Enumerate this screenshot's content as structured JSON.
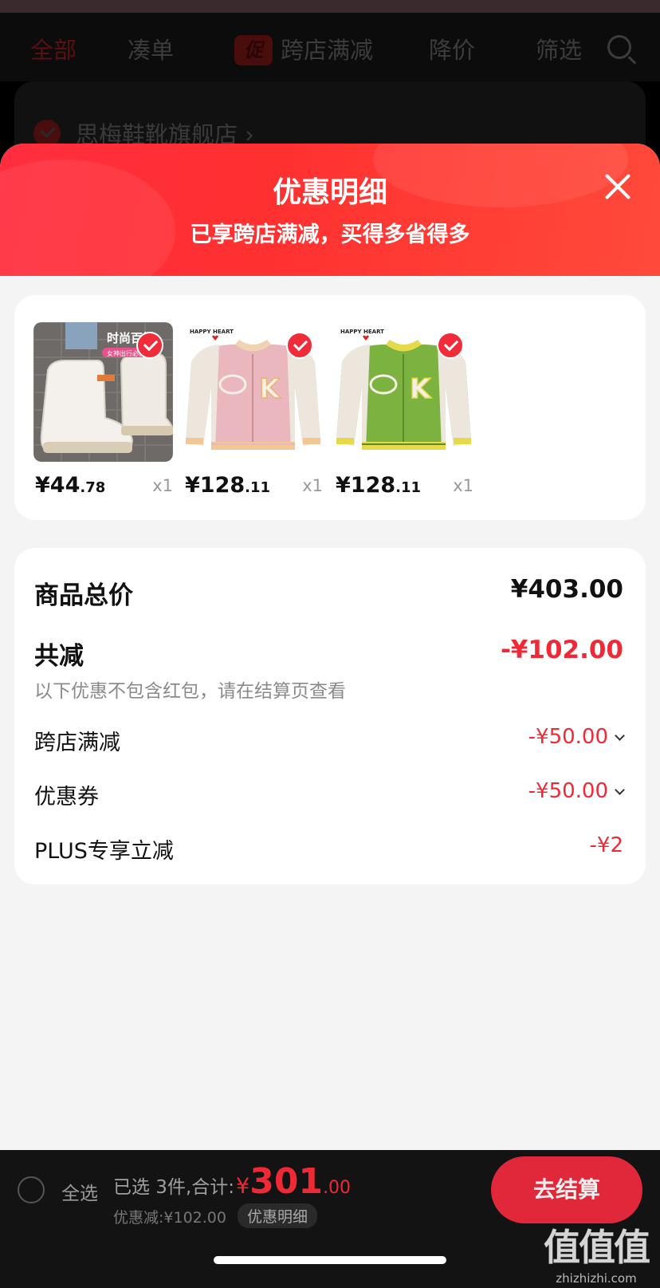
{
  "background": {
    "tabs": [
      "全部",
      "凑单",
      "跨店满减",
      "降价",
      "筛选"
    ],
    "promo_badge": "促",
    "store_name": "思梅鞋靴旗舰店 ›"
  },
  "sheet": {
    "title": "优惠明细",
    "subtitle": "已享跨店满减，买得多省得多",
    "products": [
      {
        "price_int": "¥44",
        "price_dec": ".78",
        "qty": "x1",
        "overlay_text": "时尚百搭"
      },
      {
        "price_int": "¥128",
        "price_dec": ".11",
        "qty": "x1",
        "brand_text": "HAPPY HEART"
      },
      {
        "price_int": "¥128",
        "price_dec": ".11",
        "qty": "x1",
        "brand_text": "HAPPY HEART"
      }
    ],
    "totals": {
      "goods_total_label": "商品总价",
      "goods_total_value": "¥403.00",
      "reduction_label": "共减",
      "reduction_value": "-¥102.00",
      "reduction_note": "以下优惠不包含红包，请在结算页查看",
      "items": [
        {
          "label": "跨店满减",
          "value": "-¥50.00"
        },
        {
          "label": "优惠券",
          "value": "-¥50.00"
        },
        {
          "label": "PLUS专享立减",
          "value": "-¥2"
        }
      ]
    }
  },
  "bottom_bar": {
    "select_all": "全选",
    "selected_text": "已选 3件,合计:",
    "currency": "¥",
    "total_int": "301",
    "total_dec": ".00",
    "discount_text": "优惠减:¥102.00",
    "detail_pill": "优惠明细",
    "checkout": "去结算"
  },
  "watermark": {
    "big": "值值值",
    "small": "zhizhizhi.com"
  }
}
